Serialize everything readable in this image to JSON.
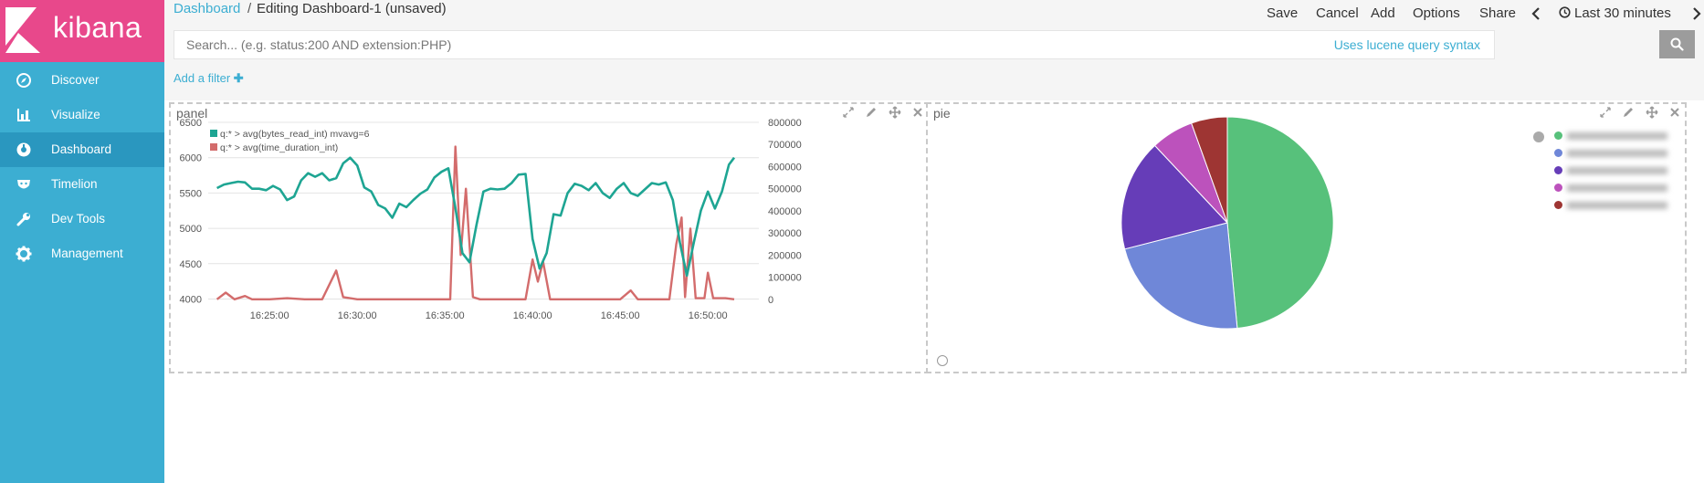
{
  "app": {
    "logo_text": "kibana"
  },
  "sidebar": {
    "items": [
      {
        "label": "Discover",
        "icon": "compass-icon"
      },
      {
        "label": "Visualize",
        "icon": "bar-chart-icon"
      },
      {
        "label": "Dashboard",
        "icon": "dashboard-icon",
        "active": true
      },
      {
        "label": "Timelion",
        "icon": "timelion-icon"
      },
      {
        "label": "Dev Tools",
        "icon": "wrench-icon"
      },
      {
        "label": "Management",
        "icon": "gear-icon"
      }
    ]
  },
  "breadcrumb": {
    "root": "Dashboard",
    "separator": "/",
    "current": "Editing Dashboard-1 (unsaved)"
  },
  "menu": {
    "save": "Save",
    "cancel": "Cancel",
    "add": "Add",
    "options": "Options",
    "share": "Share",
    "time_range": "Last 30 minutes"
  },
  "search": {
    "placeholder": "Search... (e.g. status:200 AND extension:PHP)",
    "lucene_link": "Uses lucene query syntax"
  },
  "filter": {
    "add_label": "Add a filter"
  },
  "colors": {
    "sidebar": "#3caed2",
    "logo": "#e8488b",
    "accent": "#3caed2",
    "series1": "#1ea593",
    "series2": "#d36c6c",
    "pie": [
      "#57c17b",
      "#6f87d8",
      "#663db8",
      "#bc52bc",
      "#9e3533"
    ]
  },
  "panels": {
    "left": {
      "title": "panel"
    },
    "right": {
      "title": "pie"
    }
  },
  "chart_data": [
    {
      "type": "line",
      "x_ticks": [
        "16:25:00",
        "16:30:00",
        "16:35:00",
        "16:40:00",
        "16:45:00",
        "16:50:00"
      ],
      "x_tick_minutes": [
        25,
        30,
        35,
        40,
        45,
        50
      ],
      "x_range_minutes": [
        21.5,
        51.5
      ],
      "y_left_ticks": [
        "6500",
        "6000",
        "5500",
        "5000",
        "4500",
        "4000"
      ],
      "y_left_range": [
        3980,
        6500
      ],
      "y_right_ticks": [
        "800000",
        "700000",
        "600000",
        "500000",
        "400000",
        "300000",
        "200000",
        "100000",
        "0"
      ],
      "y_right_range": [
        -5000,
        800000
      ],
      "grid": true,
      "legend_position": "top-left",
      "series": [
        {
          "name": "q:* > avg(bytes_read_int) mvavg=6",
          "axis": "left",
          "points": [
            [
              22.0,
              5570
            ],
            [
              22.4,
              5620
            ],
            [
              22.8,
              5640
            ],
            [
              23.2,
              5660
            ],
            [
              23.6,
              5650
            ],
            [
              24.0,
              5560
            ],
            [
              24.4,
              5560
            ],
            [
              24.8,
              5540
            ],
            [
              25.2,
              5600
            ],
            [
              25.6,
              5550
            ],
            [
              26.0,
              5400
            ],
            [
              26.4,
              5450
            ],
            [
              26.8,
              5680
            ],
            [
              27.2,
              5780
            ],
            [
              27.6,
              5730
            ],
            [
              28.0,
              5780
            ],
            [
              28.4,
              5680
            ],
            [
              28.8,
              5710
            ],
            [
              29.2,
              5920
            ],
            [
              29.6,
              6000
            ],
            [
              30.0,
              5890
            ],
            [
              30.4,
              5580
            ],
            [
              30.8,
              5520
            ],
            [
              31.2,
              5330
            ],
            [
              31.6,
              5280
            ],
            [
              32.0,
              5150
            ],
            [
              32.4,
              5350
            ],
            [
              32.8,
              5300
            ],
            [
              33.2,
              5400
            ],
            [
              33.6,
              5490
            ],
            [
              34.0,
              5550
            ],
            [
              34.4,
              5720
            ],
            [
              34.8,
              5800
            ],
            [
              35.2,
              5850
            ],
            [
              35.6,
              5290
            ],
            [
              36.0,
              4650
            ],
            [
              36.4,
              4520
            ],
            [
              36.8,
              5050
            ],
            [
              37.2,
              5520
            ],
            [
              37.6,
              5560
            ],
            [
              38.0,
              5550
            ],
            [
              38.4,
              5560
            ],
            [
              38.8,
              5640
            ],
            [
              39.2,
              5760
            ],
            [
              39.6,
              5770
            ],
            [
              40.0,
              4850
            ],
            [
              40.4,
              4430
            ],
            [
              40.8,
              4650
            ],
            [
              41.2,
              5200
            ],
            [
              41.6,
              5180
            ],
            [
              42.0,
              5500
            ],
            [
              42.4,
              5630
            ],
            [
              42.8,
              5600
            ],
            [
              43.2,
              5540
            ],
            [
              43.6,
              5640
            ],
            [
              44.0,
              5500
            ],
            [
              44.4,
              5430
            ],
            [
              44.8,
              5560
            ],
            [
              45.2,
              5640
            ],
            [
              45.6,
              5500
            ],
            [
              46.0,
              5460
            ],
            [
              46.4,
              5550
            ],
            [
              46.8,
              5640
            ],
            [
              47.2,
              5620
            ],
            [
              47.6,
              5650
            ],
            [
              48.0,
              5400
            ],
            [
              48.4,
              4800
            ],
            [
              48.8,
              4330
            ],
            [
              49.2,
              4800
            ],
            [
              49.6,
              5250
            ],
            [
              50.0,
              5520
            ],
            [
              50.4,
              5280
            ],
            [
              50.8,
              5520
            ],
            [
              51.2,
              5900
            ],
            [
              51.5,
              6000
            ]
          ]
        },
        {
          "name": "q:* > avg(time_duration_int)",
          "axis": "right",
          "points": [
            [
              22.0,
              0
            ],
            [
              22.5,
              30000
            ],
            [
              23.0,
              0
            ],
            [
              23.6,
              15000
            ],
            [
              24.0,
              0
            ],
            [
              25.0,
              0
            ],
            [
              26.0,
              5000
            ],
            [
              27.0,
              0
            ],
            [
              28.0,
              0
            ],
            [
              28.8,
              130000
            ],
            [
              29.2,
              10000
            ],
            [
              30.0,
              0
            ],
            [
              31.0,
              0
            ],
            [
              32.0,
              0
            ],
            [
              33.0,
              0
            ],
            [
              34.0,
              0
            ],
            [
              34.8,
              0
            ],
            [
              35.3,
              0
            ],
            [
              35.6,
              690000
            ],
            [
              35.9,
              200000
            ],
            [
              36.2,
              500000
            ],
            [
              36.6,
              10000
            ],
            [
              37.0,
              0
            ],
            [
              38.0,
              0
            ],
            [
              39.0,
              0
            ],
            [
              39.6,
              0
            ],
            [
              40.0,
              180000
            ],
            [
              40.3,
              80000
            ],
            [
              40.6,
              170000
            ],
            [
              41.0,
              0
            ],
            [
              42.0,
              0
            ],
            [
              43.0,
              0
            ],
            [
              44.0,
              0
            ],
            [
              45.0,
              0
            ],
            [
              45.6,
              40000
            ],
            [
              46.0,
              0
            ],
            [
              47.0,
              0
            ],
            [
              47.8,
              0
            ],
            [
              48.2,
              250000
            ],
            [
              48.5,
              370000
            ],
            [
              48.7,
              10000
            ],
            [
              49.0,
              320000
            ],
            [
              49.3,
              5000
            ],
            [
              49.8,
              5000
            ],
            [
              50.0,
              120000
            ],
            [
              50.3,
              5000
            ],
            [
              51.0,
              5000
            ],
            [
              51.5,
              0
            ]
          ]
        }
      ]
    },
    {
      "type": "pie",
      "values": [
        48.5,
        22.5,
        17.0,
        6.5,
        5.5
      ],
      "legend_position": "top-right",
      "legend_count": 5
    }
  ]
}
